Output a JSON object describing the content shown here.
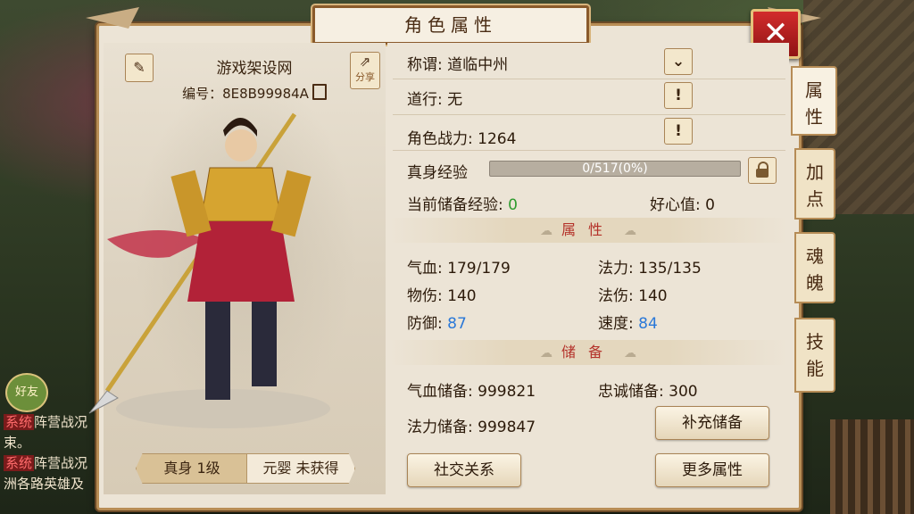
{
  "window": {
    "title": "角色属性",
    "close_symbol": "✕"
  },
  "character": {
    "name": "游戏架设网",
    "id_label": "编号：8E8B99984A",
    "edit_icon": "pencil-icon",
    "share_label": "分享"
  },
  "bottom_tabs": [
    {
      "label": "真身 1级",
      "active": true
    },
    {
      "label": "元婴 未获得",
      "active": false
    }
  ],
  "info": {
    "title_label": "称谓:",
    "title_value": "道临中州",
    "daoxing_label": "道行:",
    "daoxing_value": "无",
    "power_label": "角色战力:",
    "power_value": "1264",
    "exp_label": "真身经验",
    "exp_text": "0/517(0%)",
    "exp_progress": 0,
    "stored_exp_label": "当前储备经验:",
    "stored_exp_value": "0",
    "kindness_label": "好心值:",
    "kindness_value": "0",
    "info_button_symbol": "!"
  },
  "attributes": {
    "section_title": "属性",
    "hp_label": "气血:",
    "hp_value": "179/179",
    "mp_label": "法力:",
    "mp_value": "135/135",
    "phys_label": "物伤:",
    "phys_value": "140",
    "magic_label": "法伤:",
    "magic_value": "140",
    "def_label": "防御:",
    "def_value": "87",
    "speed_label": "速度:",
    "speed_value": "84"
  },
  "reserves": {
    "section_title": "储备",
    "hp_reserve_label": "气血储备:",
    "hp_reserve_value": "999821",
    "loyalty_reserve_label": "忠诚储备:",
    "loyalty_reserve_value": "300",
    "mp_reserve_label": "法力储备:",
    "mp_reserve_value": "999847",
    "refill_button": "补充储备"
  },
  "buttons": {
    "social": "社交关系",
    "more": "更多属性"
  },
  "side_tabs": [
    {
      "label": "属性",
      "active": true
    },
    {
      "label": "加点",
      "active": false
    },
    {
      "label": "魂魄",
      "active": false
    },
    {
      "label": "技能",
      "active": false
    }
  ],
  "chat": {
    "friends_label": "好友",
    "lines": [
      {
        "tag": "系统",
        "text": "阵营战况"
      },
      {
        "tag": "",
        "text": "束。"
      },
      {
        "tag": "系统",
        "text": "阵营战况"
      },
      {
        "tag": "",
        "text": "洲各路英雄及"
      }
    ]
  },
  "colors": {
    "accent_red": "#b4322a",
    "value_blue": "#2a78d8",
    "value_green": "#2e9b2e",
    "panel_bg": "#ece4d6"
  }
}
